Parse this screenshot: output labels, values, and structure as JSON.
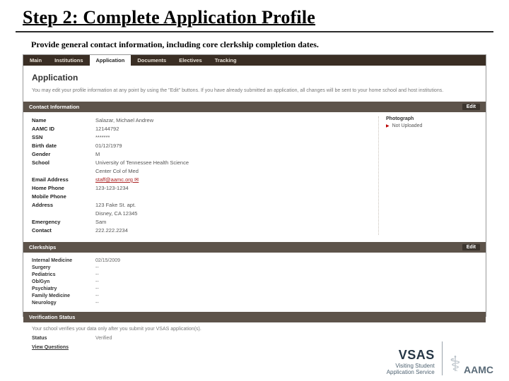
{
  "page": {
    "title": "Step 2: Complete Application Profile",
    "subtitle": "Provide general contact information, including core clerkship completion dates."
  },
  "nav": {
    "main": "Main",
    "institutions": "Institutions",
    "application": "Application",
    "documents": "Documents",
    "electives": "Electives",
    "tracking": "Tracking"
  },
  "section": {
    "app_title": "Application",
    "hint": "You may edit your profile information at any point by using the \"Edit\" buttons. If you have already submitted an application, all changes will be sent to your home school and host institutions.",
    "contact_header": "Contact Information",
    "clerkship_header": "Clerkships",
    "verification_header": "Verification Status",
    "edit_label": "Edit"
  },
  "contact": {
    "labels": {
      "name": "Name",
      "aamc": "AAMC ID",
      "ssn": "SSN",
      "birth": "Birth date",
      "gender": "Gender",
      "school": "School",
      "blank1": "",
      "email": "Email Address",
      "home": "Home Phone",
      "mobile": "Mobile Phone",
      "addr": "Address",
      "blank2": "",
      "emerg": "Emergency",
      "contact": "Contact"
    },
    "values": {
      "name": "Salazar, Michael Andrew",
      "aamc": "12144792",
      "ssn": "*******",
      "birth": "01/12/1979",
      "gender": "M",
      "school": "University of Tennessee Health Science",
      "school2": "Center Col of Med",
      "email": "staff@aamc.org ✉",
      "home": "123-123-1234",
      "mobile": "",
      "addr": "123 Fake St. apt.",
      "addr2": "Disney, CA 12345",
      "emerg": "Sam",
      "emerg2": "222.222.2234"
    },
    "photo": {
      "title": "Photograph",
      "status": "Not Uploaded"
    }
  },
  "clerkships": {
    "items": [
      {
        "label": "Internal Medicine",
        "value": "02/15/2009"
      },
      {
        "label": "Surgery",
        "value": "--"
      },
      {
        "label": "Pediatrics",
        "value": "--"
      },
      {
        "label": "Ob/Gyn",
        "value": "--"
      },
      {
        "label": "Psychiatry",
        "value": "--"
      },
      {
        "label": "Family Medicine",
        "value": "--"
      },
      {
        "label": "Neurology",
        "value": "--"
      }
    ]
  },
  "verification": {
    "note": "Your school verifies your data only after you submit your VSAS application(s).",
    "status_label": "Status",
    "status_value": "Verified",
    "questions": "View Questions"
  },
  "footer": {
    "vsas": "VSAS",
    "vsas_line1": "Visiting Student",
    "vsas_line2": "Application Service",
    "aamc": "AAMC"
  }
}
